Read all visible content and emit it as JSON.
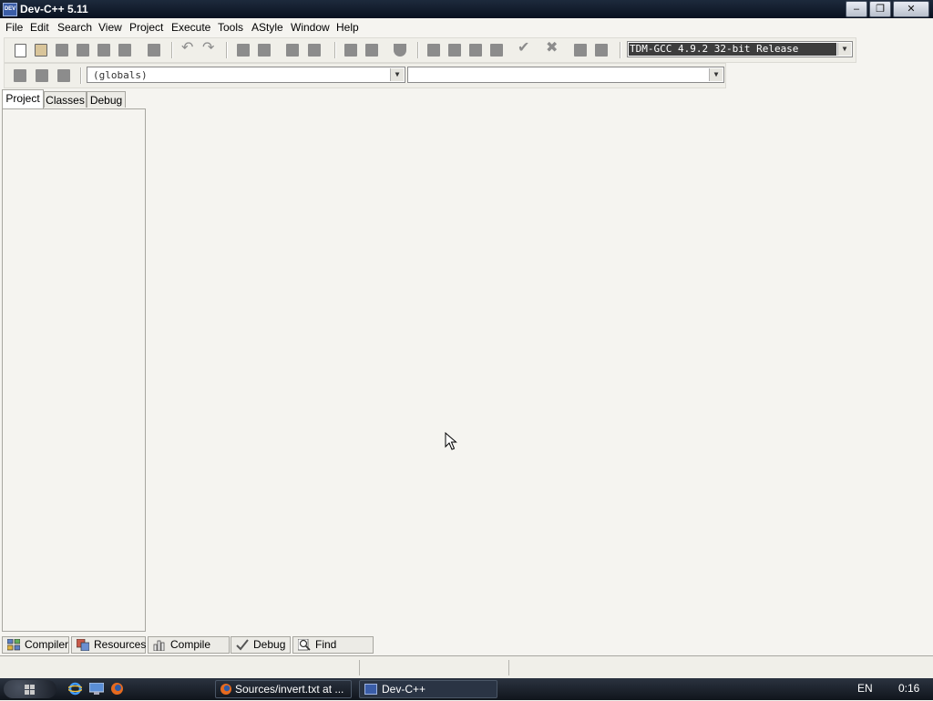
{
  "window": {
    "title": "Dev-C++ 5.11",
    "icon_text": "DEV"
  },
  "menu": [
    "File",
    "Edit",
    "Search",
    "View",
    "Project",
    "Execute",
    "Tools",
    "AStyle",
    "Window",
    "Help"
  ],
  "toolbar": {
    "compiler_select": "TDM-GCC 4.9.2 32-bit Release"
  },
  "class_browser": {
    "scope_select": "(globals)",
    "member_select": ""
  },
  "left_tabs": [
    "Project",
    "Classes",
    "Debug"
  ],
  "bottom_tabs": [
    "Compiler",
    "Resources",
    "Compile Log",
    "Debug",
    "Find Results"
  ],
  "taskbar": {
    "tasks": [
      {
        "label": "Sources/invert.txt at ..."
      },
      {
        "label": "Dev-C++"
      }
    ],
    "language": "EN",
    "clock": "0:16"
  },
  "colors": {
    "titlebar": "#0a1220",
    "window_bg": "#f5f4f0",
    "taskbar": "#10151c",
    "compiler_select_bg": "#3d3d3d"
  }
}
